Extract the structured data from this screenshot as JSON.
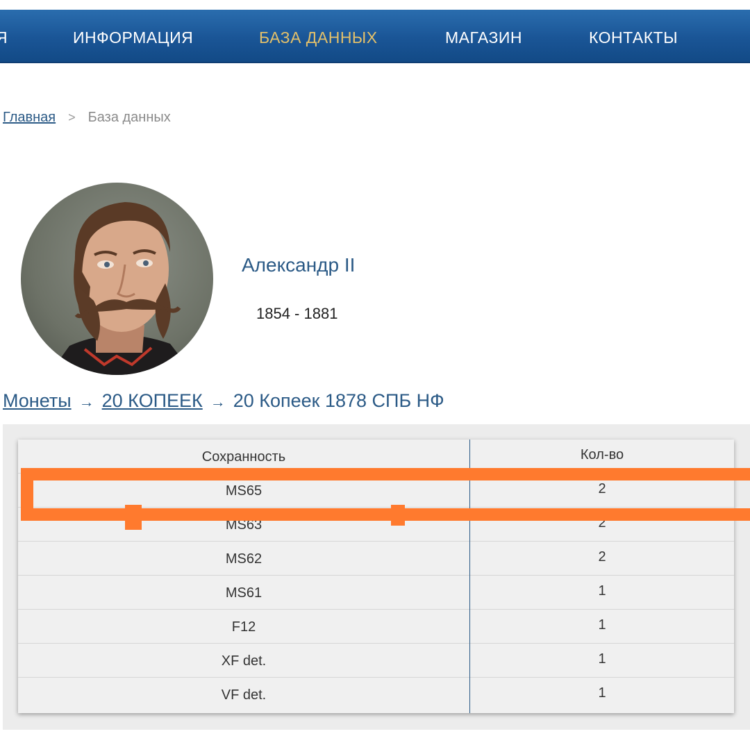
{
  "nav": {
    "items": [
      {
        "label": "Я"
      },
      {
        "label": "ИНФОРМАЦИЯ"
      },
      {
        "label": "БАЗА ДАННЫХ"
      },
      {
        "label": "МАГАЗИН"
      },
      {
        "label": "КОНТАКТЫ"
      }
    ],
    "active_color": "#e3c06a",
    "bar_color": "#1a5596"
  },
  "breadcrumb": {
    "home": "Главная",
    "separator": ">",
    "current": "База данных"
  },
  "ruler": {
    "name": "Александр II",
    "years": "1854 - 1881",
    "portrait_icon": "portrait-image"
  },
  "coin_path": {
    "root": "Монеты",
    "arrow": "→",
    "category": "20 КОПЕЕК",
    "coin": "20 Копеек 1878 СПБ НФ"
  },
  "table": {
    "headers": {
      "grade": "Сохранность",
      "qty": "Кол-во"
    },
    "rows": [
      {
        "grade": "MS65",
        "qty": "2"
      },
      {
        "grade": "MS63",
        "qty": "2"
      },
      {
        "grade": "MS62",
        "qty": "2"
      },
      {
        "grade": "MS61",
        "qty": "1"
      },
      {
        "grade": "F12",
        "qty": "1"
      },
      {
        "grade": "XF det.",
        "qty": "1"
      },
      {
        "grade": "VF det.",
        "qty": "1"
      }
    ]
  },
  "annotation": {
    "highlight_color": "#ff7a2e"
  }
}
